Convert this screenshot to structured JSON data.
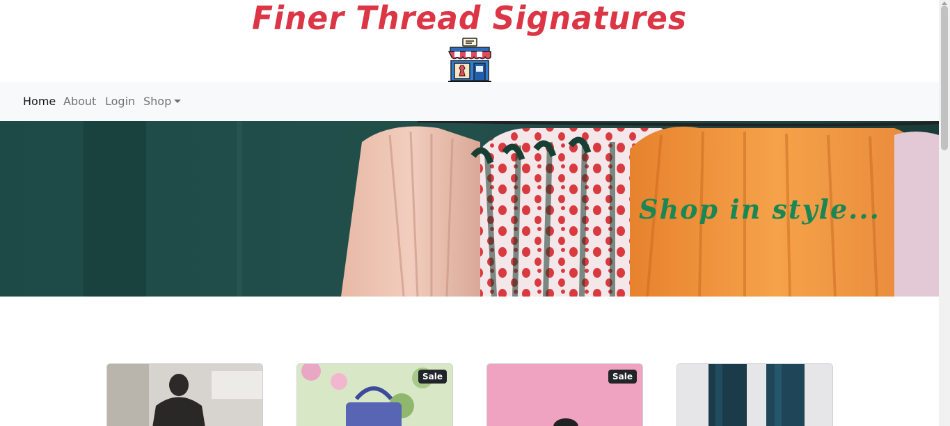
{
  "brand": {
    "title": "Finer Thread Signatures",
    "logo_icon": "store-icon",
    "title_color": "#dc3545"
  },
  "nav": {
    "items": [
      {
        "label": "Home",
        "active": true
      },
      {
        "label": "About",
        "active": false
      },
      {
        "label": "Login",
        "active": false
      },
      {
        "label": "Shop",
        "active": false,
        "dropdown": true
      }
    ]
  },
  "hero": {
    "tagline": "Shop in style...",
    "tagline_color": "#198754"
  },
  "products": [
    {
      "badge": ""
    },
    {
      "badge": "Sale"
    },
    {
      "badge": "Sale"
    },
    {
      "badge": ""
    }
  ]
}
